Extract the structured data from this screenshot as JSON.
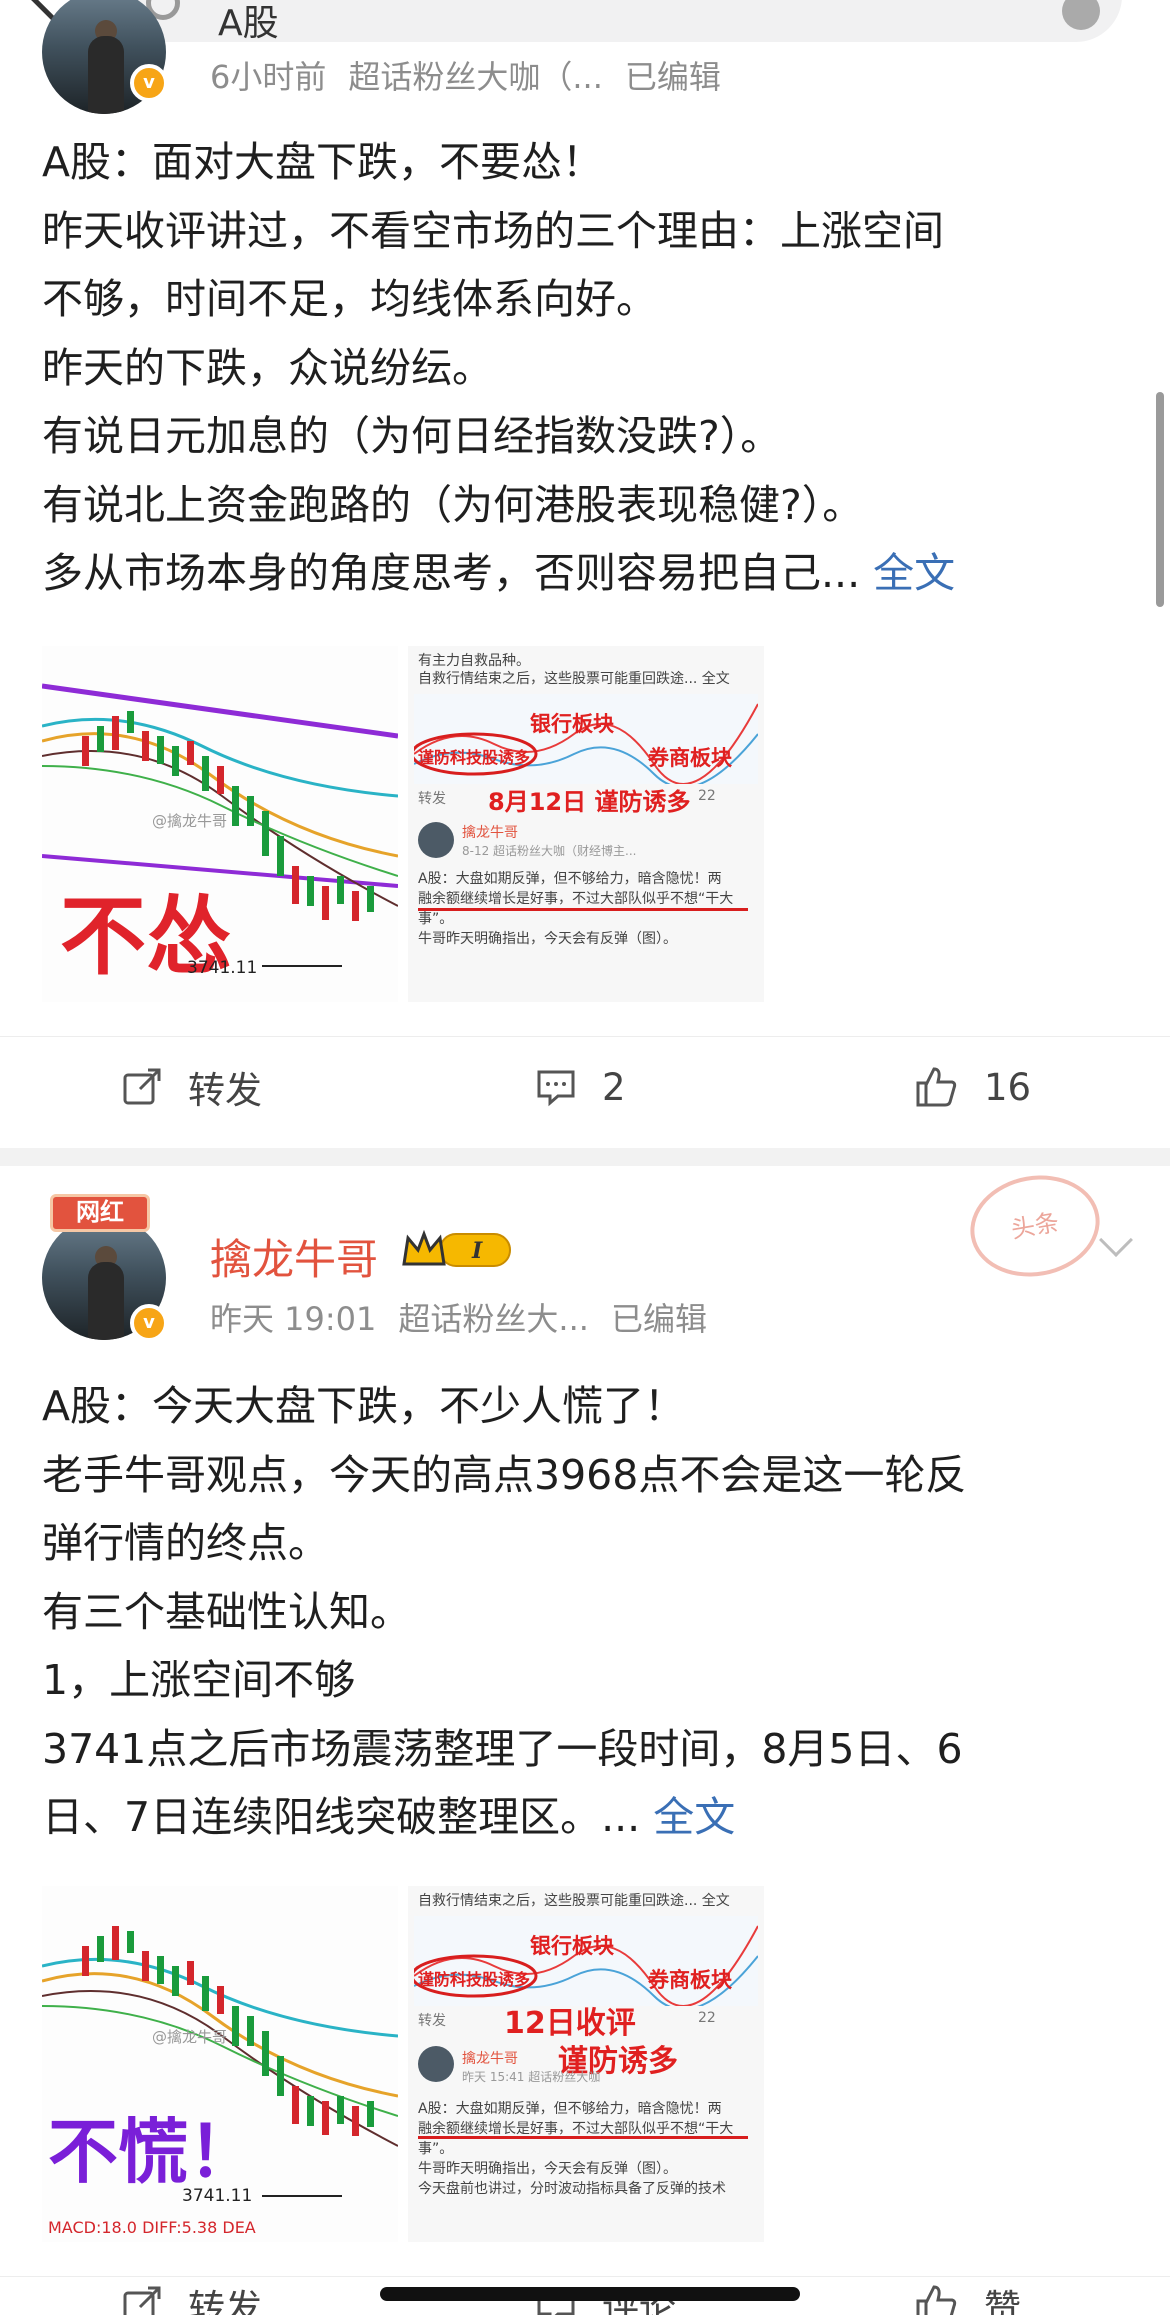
{
  "search": {
    "query": "A股"
  },
  "post1": {
    "meta": {
      "time": "6小时前",
      "source": "超话粉丝大咖（...",
      "edited": "已编辑"
    },
    "lines": [
      "A股：面对大盘下跌，不要怂！",
      "昨天收评讲过，不看空市场的三个理由：上涨空间",
      "不够，时间不足，均线体系向好。",
      "昨天的下跌，众说纷纭。",
      "有说日元加息的（为何日经指数没跌?）。",
      "有说北上资金跑路的（为何港股表现稳健?）。",
      " 多从市场本身的角度思考，否则容易把自己..."
    ],
    "more": "全文",
    "image1": {
      "big_text": "不怂",
      "price_label": "3741.11",
      "watermark": "@擒龙牛哥"
    },
    "image2": {
      "lines": [
        "有主力自救品种。",
        "自救行情结束之后，这些股票可能重回跌途...  全文"
      ],
      "tags": [
        "银行板块",
        "谨防科技股诱多",
        "券商板块"
      ],
      "date_note": "8月12日 谨防诱多",
      "repost": "转发",
      "like_count": "22",
      "author": "擒龙牛哥",
      "author_meta": "8-12  超话粉丝大咖（财经博主...",
      "quote": [
        "A股：大盘如期反弹，但不够给力，暗含隐忧！两",
        "融余额继续增长是好事，不过大部队似乎不想“干大",
        "事”。",
        "牛哥昨天明确指出，今天会有反弹（图）。"
      ]
    },
    "actions": {
      "repost": "转发",
      "comments": "2",
      "likes": "16"
    }
  },
  "post2": {
    "badge": "网红",
    "username": "擒龙牛哥",
    "level": "I",
    "stamp": "头条",
    "meta": {
      "time": "昨天 19:01",
      "source": "超话粉丝大...",
      "edited": "已编辑"
    },
    "lines": [
      "A股：今天大盘下跌，不少人慌了！",
      "老手牛哥观点，今天的高点3968点不会是这一轮反",
      "弹行情的终点。",
      "有三个基础性认知。",
      "1，上涨空间不够",
      "3741点之后市场震荡整理了一段时间，8月5日、6",
      "日、7日连续阳线突破整理区。..."
    ],
    "more": "全文",
    "image1": {
      "big_text": "不慌！",
      "price_label": "3741.11",
      "watermark": "@擒龙牛哥",
      "footer": "MACD:18.0  DIFF:5.38  DEA"
    },
    "image2": {
      "lines": [
        "自救行情结束之后，这些股票可能重回跌途...  全文"
      ],
      "tags": [
        "银行板块",
        "谨防科技股诱多",
        "券商板块"
      ],
      "date_note": "12日收评",
      "date_note2": "谨防诱多",
      "repost": "转发",
      "like_count": "22",
      "author": "擒龙牛哥",
      "author_meta": "昨天 15:41  超话粉丝大咖",
      "quote": [
        "A股：大盘如期反弹，但不够给力，暗含隐忧！两",
        "融余额继续增长是好事，不过大部队似乎不想“干大",
        "事”。",
        "牛哥昨天明确指出，今天会有反弹（图）。",
        "今天盘前也讲过，分时波动指标具备了反弹的技术"
      ]
    },
    "actions": {
      "repost": "转发",
      "comments": "评论",
      "likes": "赞"
    }
  }
}
